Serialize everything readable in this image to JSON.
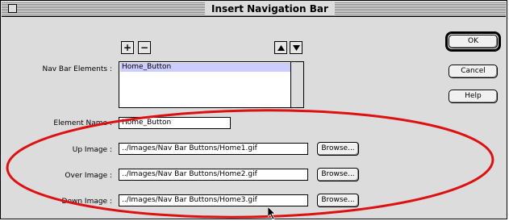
{
  "window": {
    "title": "Insert Navigation Bar",
    "close_icon": "close-box-icon"
  },
  "nav_elements": {
    "label": "Nav Bar Elements :",
    "add_label": "+",
    "remove_label": "−",
    "move_up_icon": "up-triangle-icon",
    "move_down_icon": "down-triangle-icon",
    "items": [
      "Home_Button"
    ],
    "selected": "Home_Button"
  },
  "element_name": {
    "label": "Element Name :",
    "value": "Home_Button"
  },
  "up_image": {
    "label": "Up Image :",
    "value": "../Images/Nav Bar Buttons/Home1.gif",
    "browse_label": "Browse..."
  },
  "over_image": {
    "label": "Over Image :",
    "value": "../Images/Nav Bar Buttons/Home2.gif",
    "browse_label": "Browse..."
  },
  "down_image": {
    "label": "Down Image :",
    "value": "../Images/Nav Bar Buttons/Home3.gif",
    "browse_label": "Browse..."
  },
  "buttons": {
    "ok": "OK",
    "cancel": "Cancel",
    "help": "Help"
  },
  "colors": {
    "annotation_ellipse": "#dd1111",
    "list_selection": "#ccccff",
    "dialog_background": "#dcdcdc"
  }
}
